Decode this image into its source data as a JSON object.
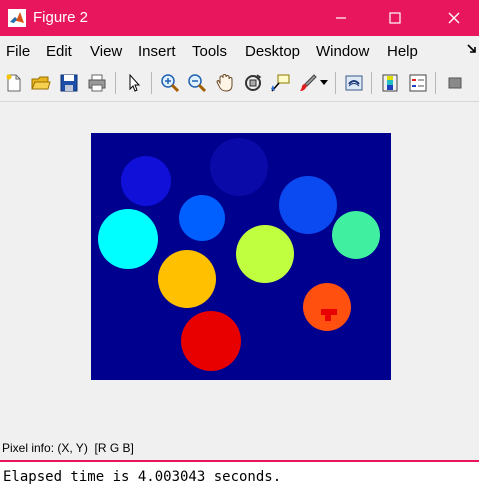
{
  "window": {
    "title": "Figure 2",
    "accent_color": "#e8175d",
    "controls": [
      "minimize-icon",
      "maximize-icon",
      "close-icon"
    ]
  },
  "menu": {
    "items": [
      {
        "label": "File"
      },
      {
        "label": "Edit"
      },
      {
        "label": "View"
      },
      {
        "label": "Insert"
      },
      {
        "label": "Tools"
      },
      {
        "label": "Desktop"
      },
      {
        "label": "Window"
      },
      {
        "label": "Help"
      }
    ]
  },
  "toolbar": {
    "tools": [
      "new-figure-icon",
      "open-file-icon",
      "save-icon",
      "print-icon",
      "pointer-icon",
      "zoom-in-icon",
      "zoom-out-icon",
      "pan-icon",
      "rotate-3d-icon",
      "data-cursor-icon",
      "brush-icon",
      "brush-dropdown-icon",
      "link-plot-icon",
      "colorbar-icon",
      "legend-icon",
      "hide-plot-tools-icon"
    ]
  },
  "image": {
    "background_color": "#00008f",
    "objects_colors": [
      "#1010d8",
      "#0a0aa8",
      "#0a4af0",
      "#0060ff",
      "#00ffff",
      "#0080ff",
      "#c0ff40",
      "#40f0a0",
      "#ffc000",
      "#ff5010",
      "#e80000"
    ]
  },
  "status": {
    "pixel_info": "Pixel info: (X, Y)  [R G B]"
  },
  "command_window": {
    "output": "Elapsed time is 4.003043 seconds."
  }
}
